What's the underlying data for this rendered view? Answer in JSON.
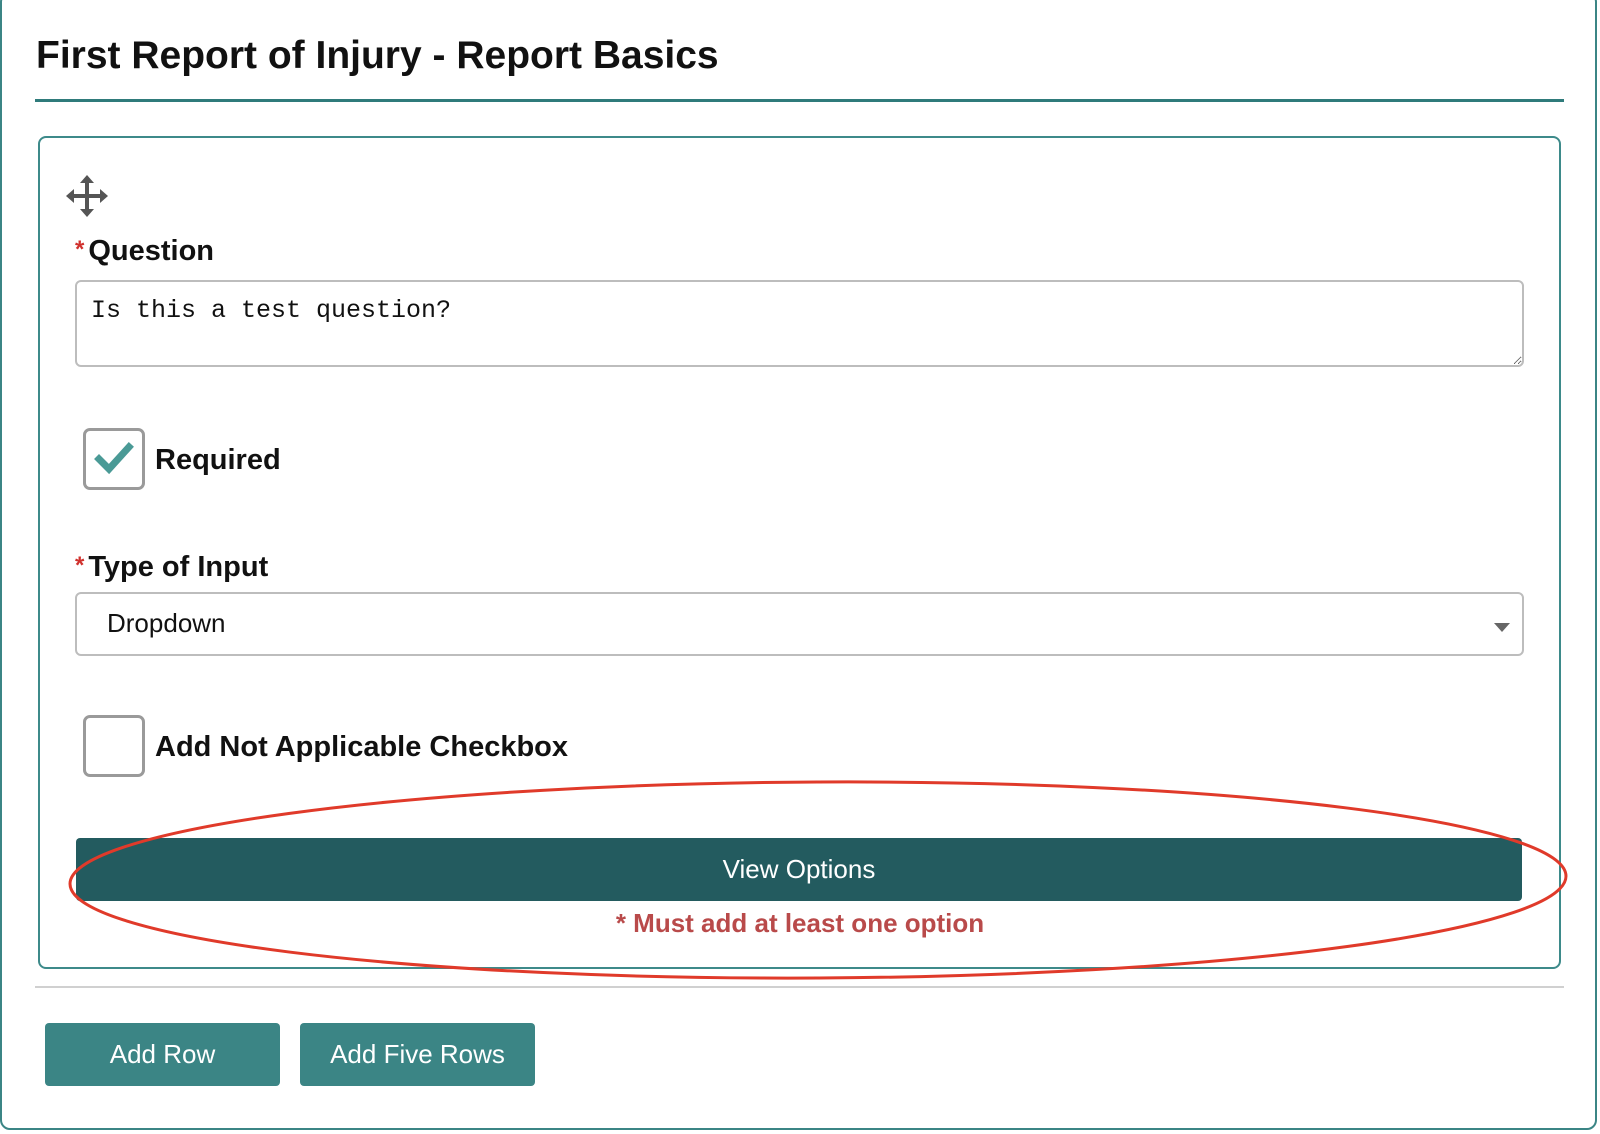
{
  "header": {
    "title": "First Report of Injury - Report Basics"
  },
  "question_card": {
    "move_icon": "move-arrows-icon",
    "question": {
      "label": "Question",
      "required_marker": "*",
      "value": "Is this a test question?"
    },
    "required_checkbox": {
      "label": "Required",
      "checked": true
    },
    "input_type": {
      "label": "Type of Input",
      "required_marker": "*",
      "selected": "Dropdown"
    },
    "not_applicable_checkbox": {
      "label": "Add Not Applicable Checkbox",
      "checked": false
    },
    "view_options_label": "View Options",
    "error_message": "* Must add at least one option"
  },
  "actions": {
    "add_row_label": "Add Row",
    "add_five_rows_label": "Add Five Rows"
  },
  "colors": {
    "accent": "#3b8585",
    "primary_button": "#235b5f",
    "error_text": "#b94a4a",
    "required_star": "#d0312d",
    "callout_annotation": "#e03a2a"
  }
}
